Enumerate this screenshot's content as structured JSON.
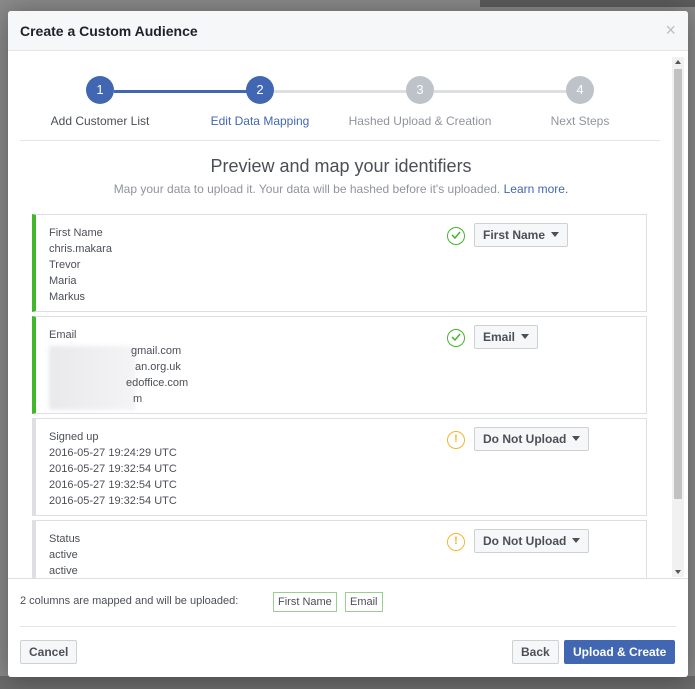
{
  "modal": {
    "title": "Create a Custom Audience",
    "close_glyph": "×"
  },
  "stepper": {
    "steps": [
      {
        "number": "1",
        "label": "Add Customer List",
        "state": "done"
      },
      {
        "number": "2",
        "label": "Edit Data Mapping",
        "state": "active"
      },
      {
        "number": "3",
        "label": "Hashed Upload & Creation",
        "state": "pending"
      },
      {
        "number": "4",
        "label": "Next Steps",
        "state": "pending"
      }
    ]
  },
  "preview": {
    "heading": "Preview and map your identifiers",
    "subheading": "Map your data to upload it. Your data will be hashed before it's uploaded.",
    "learn_more": "Learn more."
  },
  "columns": [
    {
      "header": "First Name",
      "values": [
        "chris.makara",
        "Trevor",
        "Maria",
        "Markus"
      ],
      "mapping": "First Name",
      "status": "mapped",
      "status_icon": "check-icon"
    },
    {
      "header": "Email",
      "values": [
        "gmail.com",
        "an.org.uk",
        "edoffice.com",
        "m"
      ],
      "mapping": "Email",
      "status": "mapped",
      "status_icon": "check-icon"
    },
    {
      "header": "Signed up",
      "values": [
        "2016-05-27 19:24:29 UTC",
        "2016-05-27 19:32:54 UTC",
        "2016-05-27 19:32:54 UTC",
        "2016-05-27 19:32:54 UTC"
      ],
      "mapping": "Do Not Upload",
      "status": "unmapped",
      "status_icon": "warning-icon"
    },
    {
      "header": "Status",
      "values": [
        "active",
        "active"
      ],
      "mapping": "Do Not Upload",
      "status": "unmapped",
      "status_icon": "warning-icon"
    }
  ],
  "summary": {
    "text": "2 columns are mapped and will be uploaded:",
    "tags": [
      "First Name",
      "Email"
    ]
  },
  "buttons": {
    "cancel": "Cancel",
    "back": "Back",
    "upload": "Upload & Create"
  },
  "colors": {
    "primary": "#4267b2",
    "mapped": "#42b72a",
    "warning": "#f5b533",
    "pending": "#bec3c9"
  }
}
